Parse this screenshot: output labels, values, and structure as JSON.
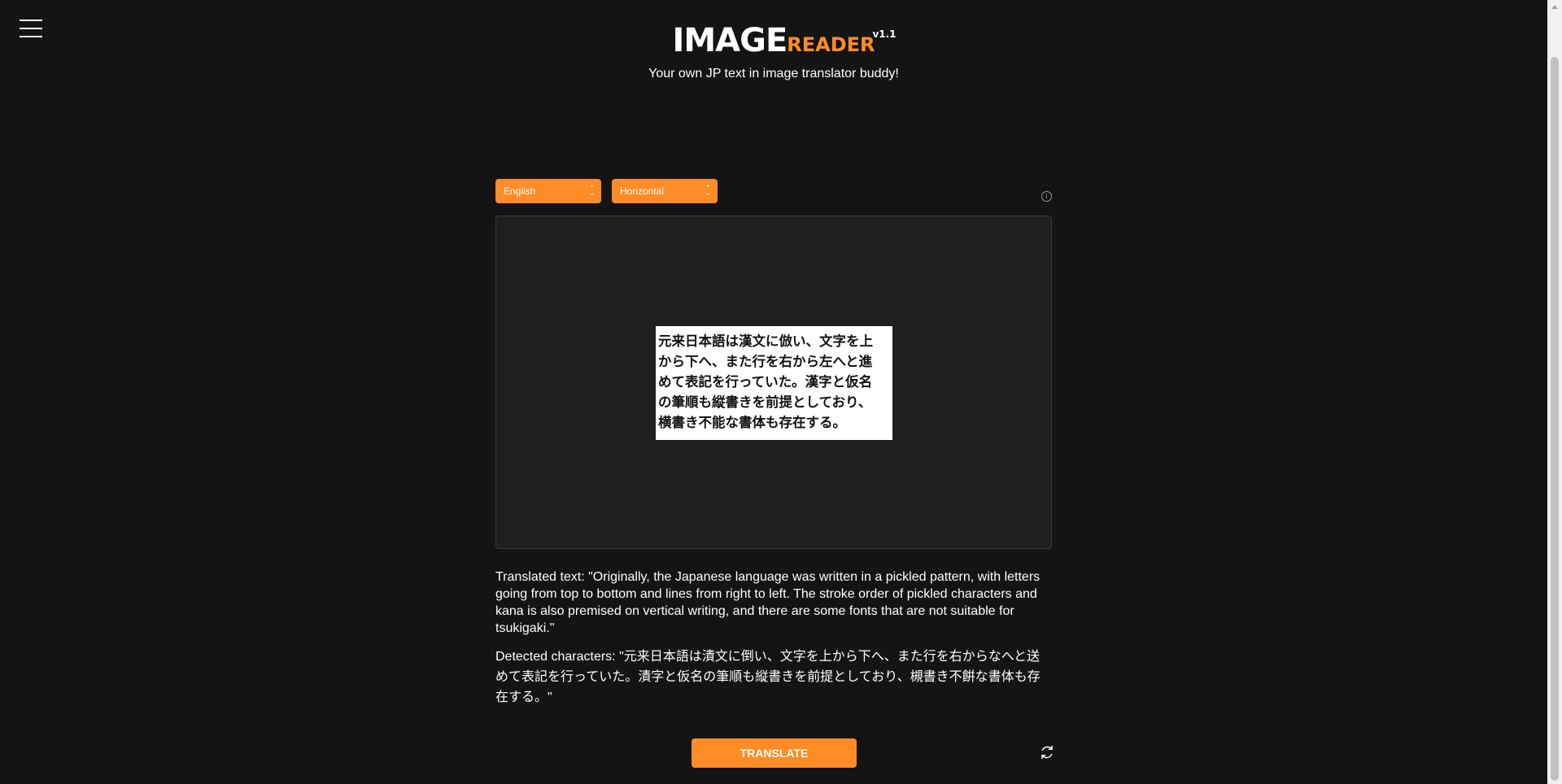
{
  "header": {
    "logo_main": "IMAGE",
    "logo_accent": "READER",
    "logo_version": "v1.1",
    "tagline": "Your own JP text in image translator buddy!"
  },
  "controls": {
    "language_selected": "English",
    "orientation_selected": "Horizontal",
    "info_icon": "info-icon"
  },
  "preview": {
    "image_text_lines": [
      "元来日本語は漢文に倣い、文字を上",
      "から下へ、また行を右から左へと進",
      "めて表記を行っていた。漢字と仮名",
      "の筆順も縦書きを前提としており、",
      "横書き不能な書体も存在する。"
    ]
  },
  "results": {
    "translated_text": "Translated text: \"Originally, the Japanese language was written in a pickled pattern, with letters going from top to bottom and lines from right to left. The stroke order of pickled characters and kana is also premised on vertical writing, and there are some fonts that are not suitable for tsukigaki.\"",
    "detected_characters": "Detected characters: \"元来日本語は漬文に倒い、文字を上から下へ、また行を右からなへと送めて表記を行っていた。漬字と仮名の筆順も縦書きを前提としており、槻書き不餠な書体も存在する。\""
  },
  "actions": {
    "translate_label": "TRANSLATE",
    "refresh_icon": "refresh-icon",
    "menu_icon": "hamburger-menu-icon"
  },
  "colors": {
    "background": "#141414",
    "accent": "#ff8c26",
    "panel": "#1f1f1f"
  }
}
